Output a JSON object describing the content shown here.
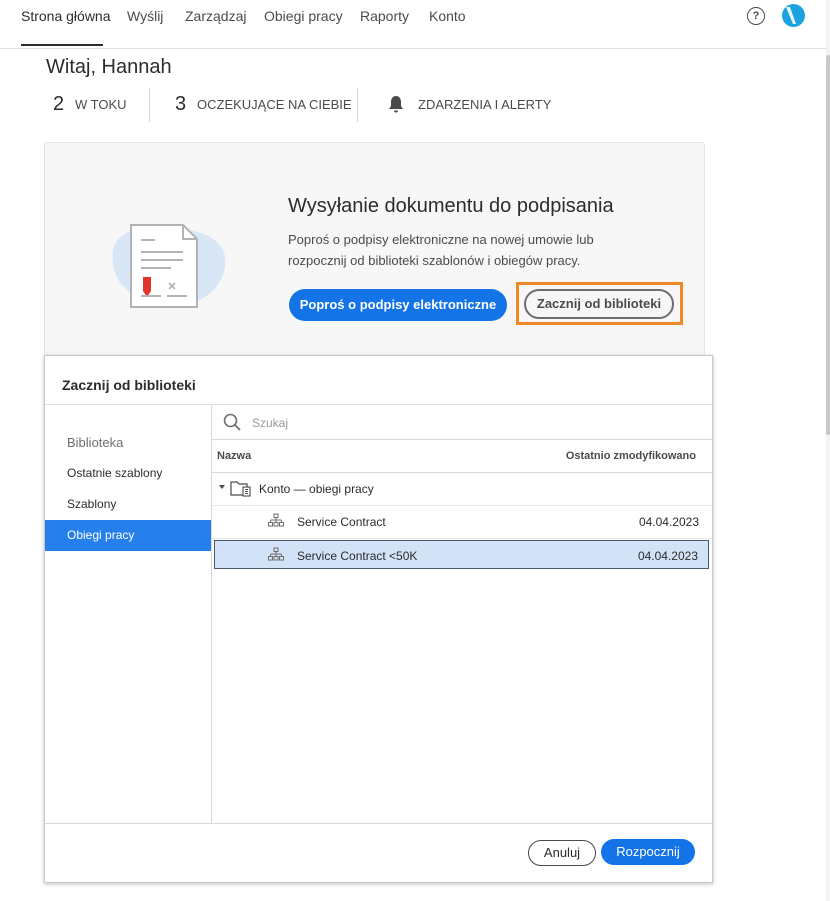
{
  "nav": {
    "items": [
      "Strona główna",
      "Wyślij",
      "Zarządzaj",
      "Obiegi pracy",
      "Raporty",
      "Konto"
    ],
    "active_index": 0,
    "help_glyph": "?"
  },
  "welcome": "Witaj, Hannah",
  "stats": {
    "in_progress_count": "2",
    "in_progress_label": "W TOKU",
    "waiting_count": "3",
    "waiting_label": "OCZEKUJĄCE NA CIEBIE",
    "alerts_label": "ZDARZENIA I ALERTY"
  },
  "card": {
    "title": "Wysyłanie dokumentu do podpisania",
    "description": "Poproś o podpisy elektroniczne na nowej umowie lub rozpocznij od biblioteki szablonów i obiegów pracy.",
    "primary_button": "Poproś o podpisy elektroniczne",
    "secondary_button": "Zacznij od biblioteki"
  },
  "modal": {
    "title": "Zacznij od biblioteki",
    "sidebar": {
      "heading": "Biblioteka",
      "items": [
        "Ostatnie szablony",
        "Szablony",
        "Obiegi pracy"
      ],
      "active_index": 2
    },
    "search_placeholder": "Szukaj",
    "columns": {
      "name": "Nazwa",
      "modified": "Ostatnio zmodyfikowano"
    },
    "folder": {
      "name": "Konto — obiegi pracy"
    },
    "rows": [
      {
        "name": "Service Contract",
        "date": "04.04.2023",
        "selected": false
      },
      {
        "name": "Service Contract <50K",
        "date": "04.04.2023",
        "selected": true
      }
    ],
    "cancel_label": "Anuluj",
    "start_label": "Rozpocznij"
  },
  "colors": {
    "accent": "#1473e6",
    "highlight": "#f08a28",
    "selected_row": "#d2e3f8",
    "sidebar_active": "#2680eb"
  }
}
